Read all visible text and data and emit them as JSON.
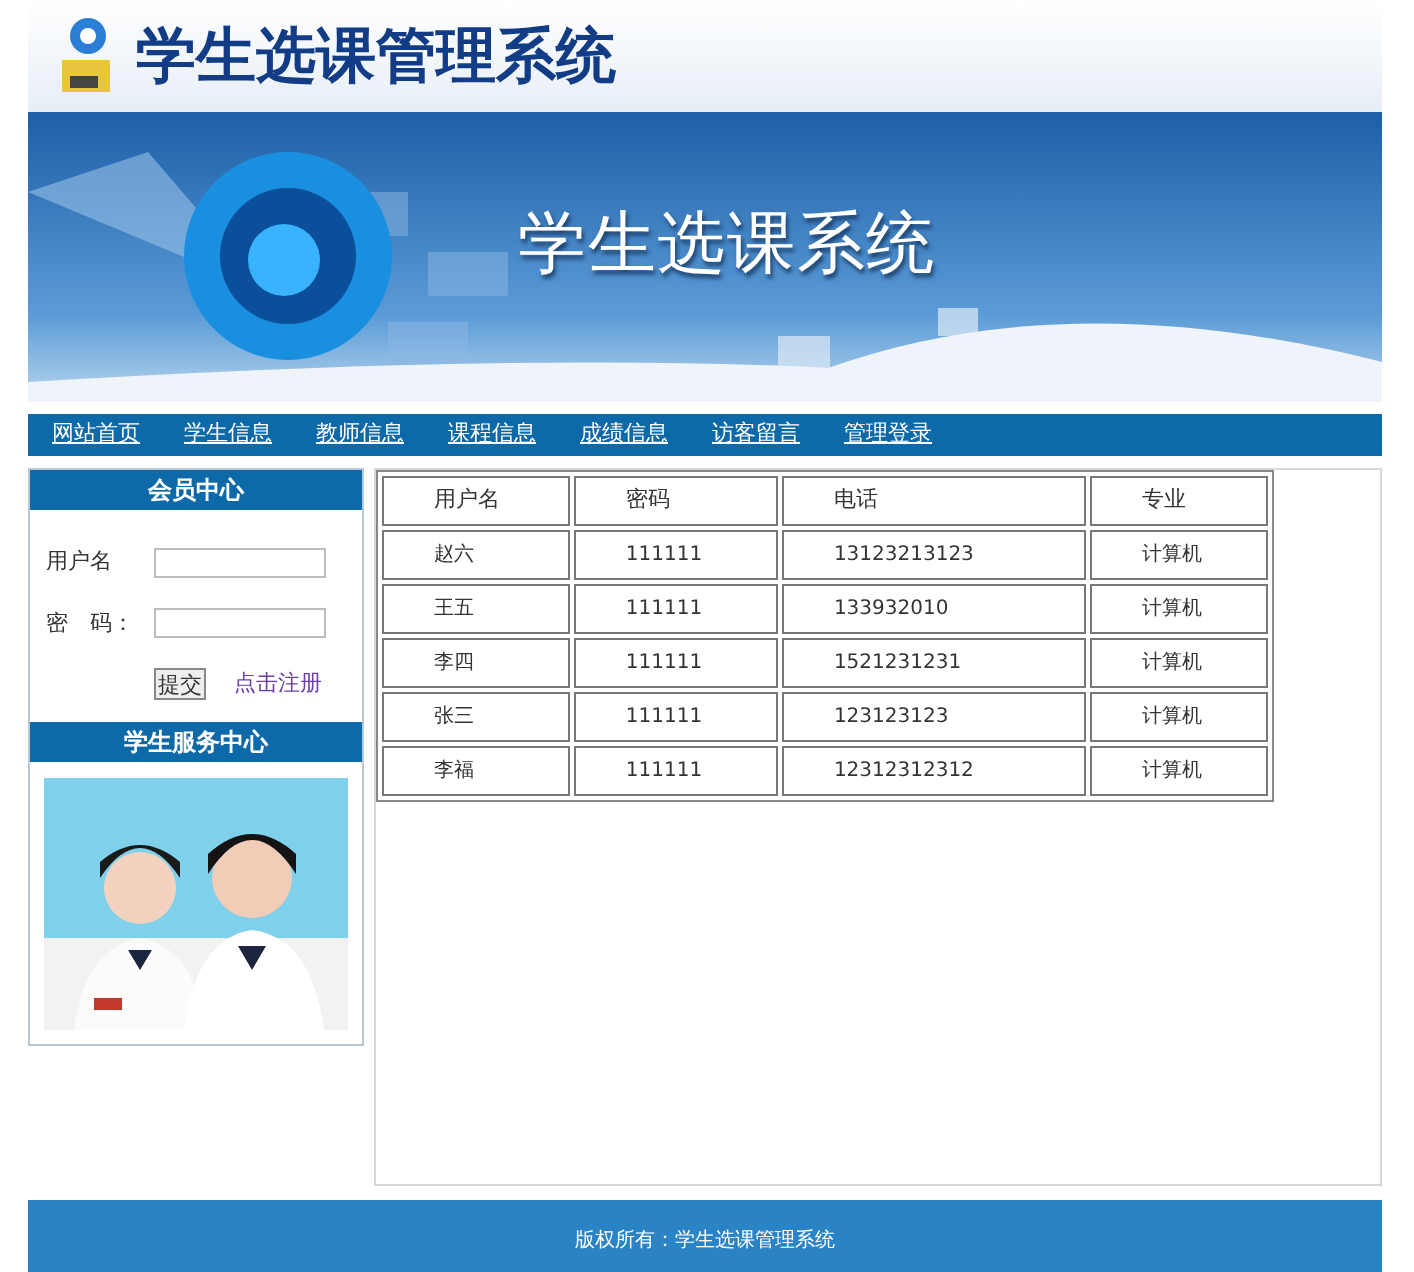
{
  "header": {
    "title": "学生选课管理系统"
  },
  "banner": {
    "title": "学生选课系统"
  },
  "nav": [
    {
      "label": "网站首页"
    },
    {
      "label": "学生信息"
    },
    {
      "label": "教师信息"
    },
    {
      "label": "课程信息"
    },
    {
      "label": "成绩信息"
    },
    {
      "label": "访客留言"
    },
    {
      "label": "管理登录"
    }
  ],
  "member_panel": {
    "title": "会员中心",
    "fields": [
      {
        "label": "用户名"
      },
      {
        "label": "密　码："
      }
    ],
    "submit": "提交",
    "register_link": "点击注册"
  },
  "service_panel": {
    "title": "学生服务中心"
  },
  "table": {
    "columns": [
      "用户名",
      "密码",
      "电话",
      "专业"
    ],
    "rows": [
      [
        "赵六",
        "111111",
        "13123213123",
        "计算机"
      ],
      [
        "王五",
        "111111",
        "133932010",
        "计算机"
      ],
      [
        "李四",
        "111111",
        "1521231231",
        "计算机"
      ],
      [
        "张三",
        "111111",
        "123123123",
        "计算机"
      ],
      [
        "李福",
        "111111",
        "12312312312",
        "计算机"
      ]
    ]
  },
  "footer": {
    "text": "版权所有：学生选课管理系统"
  }
}
